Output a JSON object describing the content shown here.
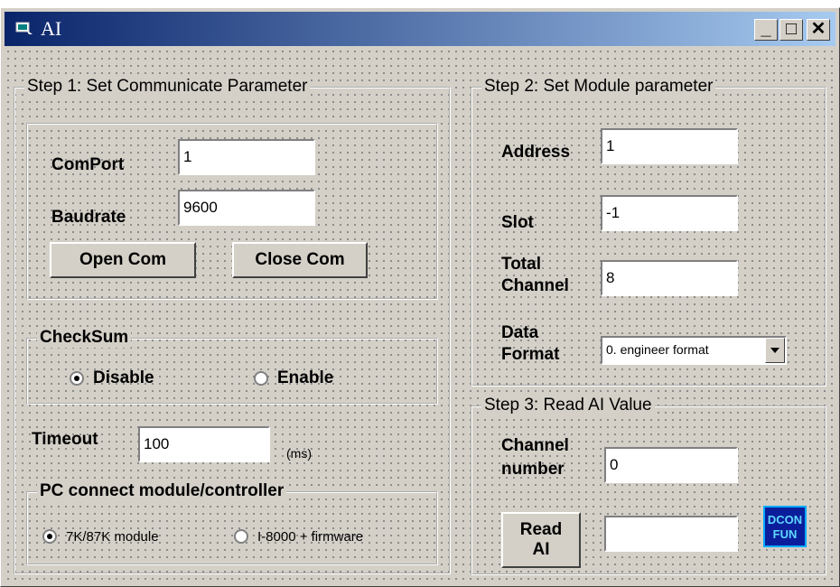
{
  "window": {
    "title": "AI",
    "buttons": {
      "minimize": "_",
      "maximize": "□",
      "close": "✕"
    }
  },
  "step1": {
    "legend": "Step 1: Set Communicate Parameter",
    "comport": {
      "label": "ComPort",
      "value": "1"
    },
    "baudrate": {
      "label": "Baudrate",
      "value": "9600"
    },
    "open_label": "Open Com",
    "close_label": "Close Com",
    "checksum": {
      "legend": "CheckSum",
      "disable": "Disable",
      "enable": "Enable",
      "selected": "Disable"
    },
    "timeout": {
      "label": "Timeout",
      "value": "100",
      "unit": "(ms)"
    },
    "pc_connect": {
      "legend": "PC connect module/controller",
      "opt1": "7K/87K module",
      "opt2": "I-8000 + firmware",
      "selected": "7K/87K module"
    }
  },
  "step2": {
    "legend": "Step 2: Set Module parameter",
    "address": {
      "label": "Address",
      "value": "1"
    },
    "slot": {
      "label": "Slot",
      "value": "-1"
    },
    "total_channel": {
      "label1": "Total",
      "label2": "Channel",
      "value": "8"
    },
    "data_format": {
      "label1": "Data",
      "label2": "Format",
      "value": "0. engineer format"
    }
  },
  "step3": {
    "legend": "Step 3: Read AI Value",
    "channel": {
      "label1": "Channel",
      "label2": "number",
      "value": "0"
    },
    "read_label1": "Read",
    "read_label2": "AI",
    "result_value": ""
  },
  "logo": {
    "line1": "DCON",
    "line2": "FUN"
  },
  "colors": {
    "title_start": "#0a246a",
    "title_end": "#a6caf0",
    "face": "#d4d0c8"
  }
}
